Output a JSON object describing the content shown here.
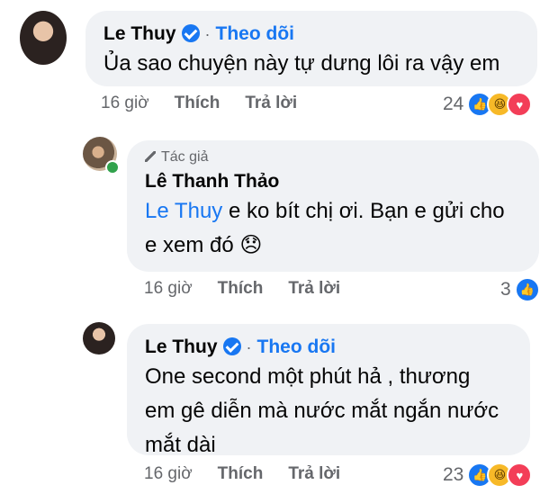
{
  "comments": [
    {
      "author": "Le Thuy",
      "follow_label": "Theo dõi",
      "separator": "·",
      "text": "Ủa sao chuyện này tự dưng lôi ra vậy em",
      "time": "16 giờ",
      "like_label": "Thích",
      "reply_label": "Trả lời",
      "reaction_count": "24",
      "reaction_icons": [
        "like-icon",
        "haha-icon",
        "love-icon"
      ]
    },
    {
      "author_badge": "Tác giả",
      "author": "Lê Thanh Thảo",
      "mention": "Le Thuy",
      "text_line1": " e ko bít chị ơi. Bạn e gửi cho",
      "text_line2": "e xem đó",
      "emoji": "😞",
      "time": "16 giờ",
      "like_label": "Thích",
      "reply_label": "Trả lời",
      "reaction_count": "3",
      "reaction_icons": [
        "like-icon"
      ]
    },
    {
      "author": "Le Thuy",
      "follow_label": "Theo dõi",
      "separator": "·",
      "text_line1": "One second một phút hả , thương",
      "text_line2": "em gê diễn mà nước mắt ngắn nước",
      "text_line3": "mắt dài",
      "time": "16 giờ",
      "like_label": "Thích",
      "reply_label": "Trả lời",
      "reaction_count": "23",
      "reaction_icons": [
        "like-icon",
        "haha-icon",
        "love-icon"
      ]
    }
  ],
  "colors": {
    "link": "#1877f2",
    "bubble": "#f0f2f5",
    "meta": "#65676b"
  }
}
